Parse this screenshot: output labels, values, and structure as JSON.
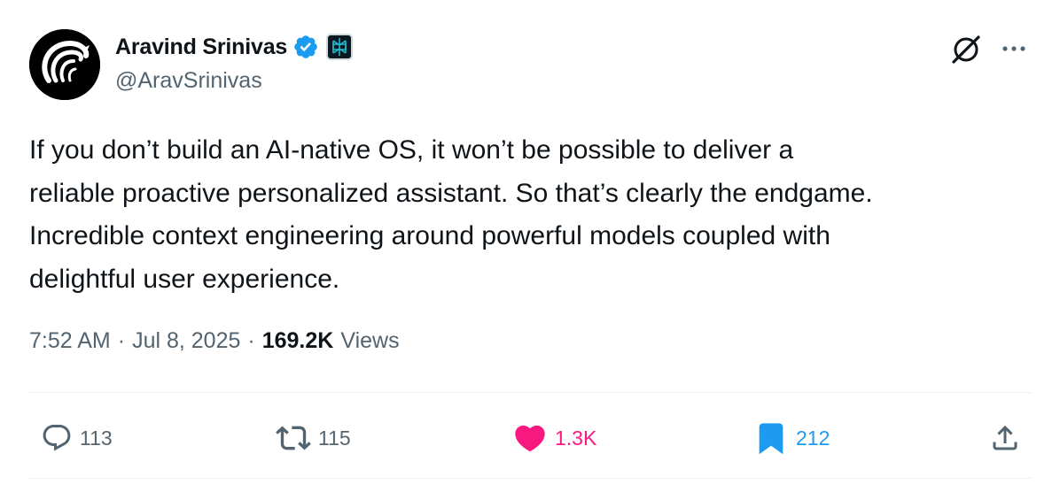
{
  "author": {
    "display_name": "Aravind Srinivas",
    "handle": "@AravSrinivas",
    "verified": true,
    "affiliate_badge": "perplexity-logo"
  },
  "header_icons": [
    "grok-icon",
    "more-icon"
  ],
  "tweet": {
    "lines": [
      "If you don’t build an AI-native OS, it won’t be possible to deliver a",
      "reliable proactive personalized assistant. So that’s clearly the endgame.",
      "Incredible context engineering around powerful models coupled with",
      "delightful user experience."
    ]
  },
  "meta": {
    "time": "7:52 AM",
    "sep1": "·",
    "date": "Jul 8, 2025",
    "sep2": "·",
    "views_count": "169.2K",
    "views_label": "Views"
  },
  "actions": {
    "replies": "113",
    "retweets": "115",
    "likes": "1.3K",
    "bookmarks": "212"
  },
  "colors": {
    "text": "#0f1419",
    "secondary": "#536471",
    "verified_blue": "#1d9bf0",
    "like_pink": "#f91880",
    "bookmark_blue": "#1d9bf0",
    "divider": "#eff3f4"
  }
}
